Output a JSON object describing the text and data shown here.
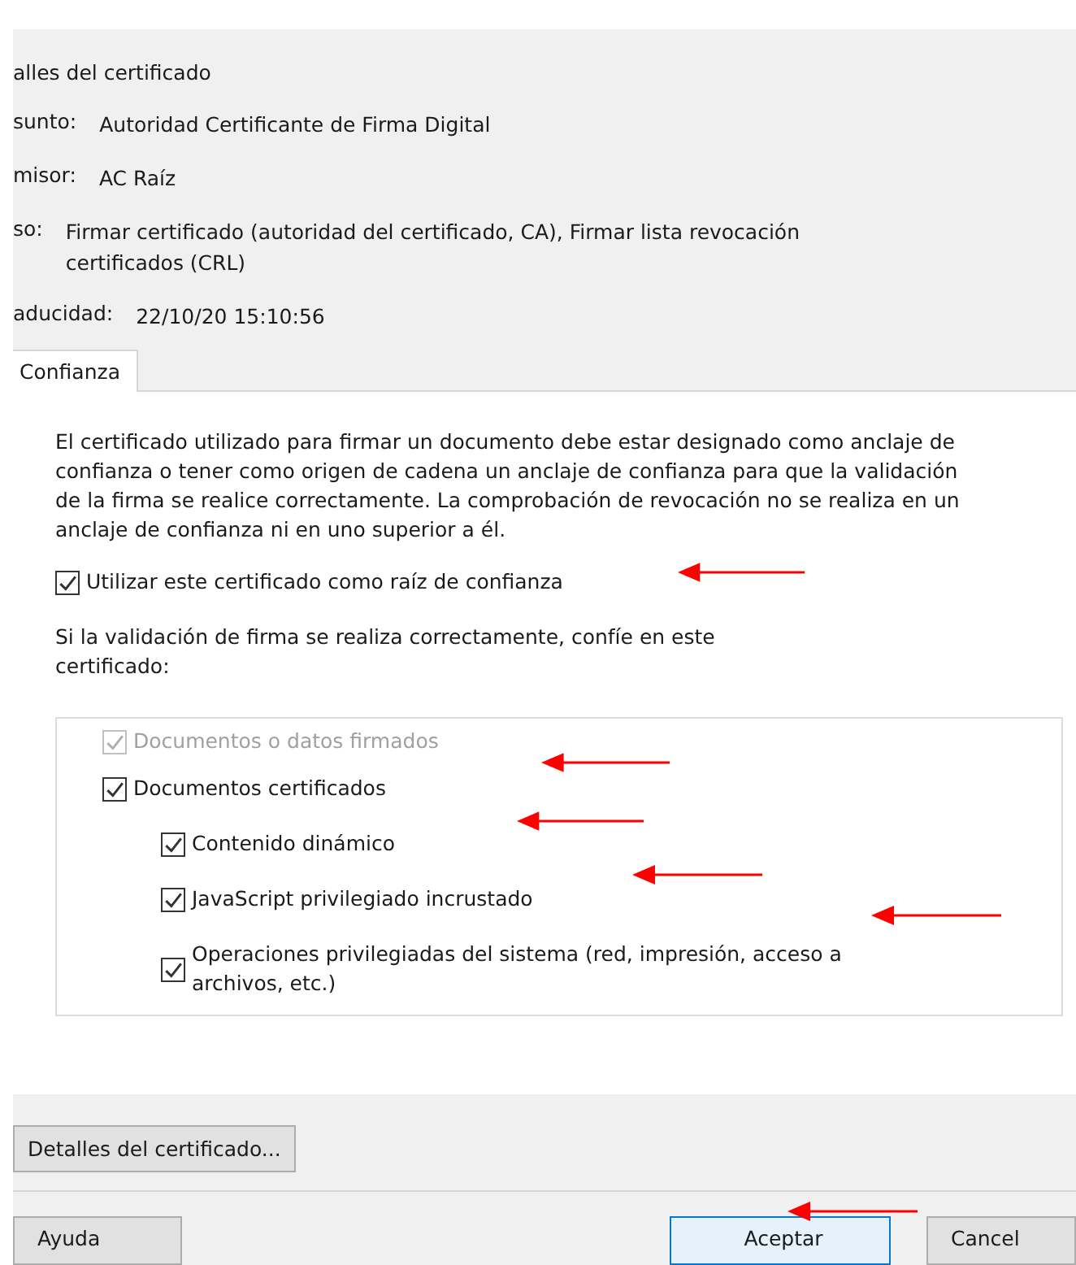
{
  "details": {
    "heading": "alles del certificado",
    "fields": [
      {
        "label": "sunto:",
        "value": "Autoridad Certificante de Firma Digital"
      },
      {
        "label": "misor:",
        "value": "AC Raíz"
      },
      {
        "label": "so:",
        "value": "Firmar certificado (autoridad del certificado, CA), Firmar lista revocación certificados (CRL)"
      },
      {
        "label": "aducidad:",
        "value": "22/10/20 15:10:56"
      }
    ]
  },
  "tabs": [
    {
      "label": "Confianza",
      "selected": true
    }
  ],
  "trust": {
    "description": "El certificado utilizado para firmar un documento debe estar designado como anclaje de confianza o tener como origen de cadena un anclaje de confianza para que la validación de la firma se realice correctamente. La comprobación de revocación no se realiza en un anclaje de confianza ni en uno superior a él.",
    "root_option": {
      "label": "Utilizar este certificado como raíz de confianza",
      "checked": true,
      "disabled": false
    },
    "prompt": "Si la validación de firma se realiza correctamente, confíe en este certificado:",
    "options": [
      {
        "label": "Documentos o datos firmados",
        "checked": true,
        "disabled": true
      },
      {
        "label": "Documentos certificados",
        "checked": true,
        "disabled": false,
        "children": [
          {
            "label": "Contenido dinámico",
            "checked": true,
            "disabled": false
          },
          {
            "label": "JavaScript privilegiado incrustado",
            "checked": true,
            "disabled": false
          },
          {
            "label": "Operaciones privilegiadas del sistema (red, impresión, acceso a archivos, etc.)",
            "checked": true,
            "disabled": false
          }
        ]
      }
    ]
  },
  "details_button": "Detalles del certificado...",
  "buttons": [
    {
      "label": "Ayuda",
      "kind": "normal"
    },
    {
      "label": "Aceptar",
      "kind": "default"
    },
    {
      "label": "Cancel",
      "kind": "normal"
    }
  ]
}
